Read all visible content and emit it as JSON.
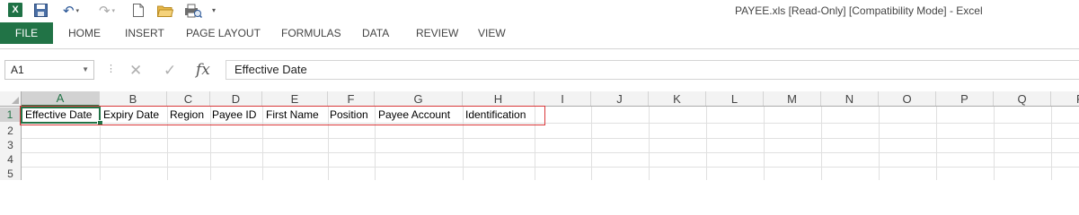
{
  "window": {
    "title": "PAYEE.xls  [Read-Only]  [Compatibility Mode] - Excel"
  },
  "quick_access": {
    "icons": [
      "excel-logo",
      "save-icon",
      "undo-icon",
      "redo-icon",
      "new-document-icon",
      "open-folder-icon",
      "print-preview-icon",
      "customize-toolbar-icon"
    ],
    "excel_logo_text": "X"
  },
  "ribbon": {
    "tabs": [
      "FILE",
      "HOME",
      "INSERT",
      "PAGE LAYOUT",
      "FORMULAS",
      "DATA",
      "REVIEW",
      "VIEW"
    ],
    "accent_color": "#217346"
  },
  "formula_bar": {
    "name_box": "A1",
    "fx_label": "fx",
    "content": "Effective Date"
  },
  "sheet": {
    "columns": [
      "A",
      "B",
      "C",
      "D",
      "E",
      "F",
      "G",
      "H",
      "I",
      "J",
      "K",
      "L",
      "M",
      "N",
      "O",
      "P",
      "Q",
      "R"
    ],
    "rows": [
      "1",
      "2",
      "3",
      "4",
      "5"
    ],
    "row1_cells": [
      "Effective Date",
      "Expiry Date",
      "Region",
      "Payee ID",
      "First Name",
      "Position",
      "Payee Account",
      "Identification"
    ],
    "active_cell": "A1",
    "highlight_color": "#d9383a"
  }
}
